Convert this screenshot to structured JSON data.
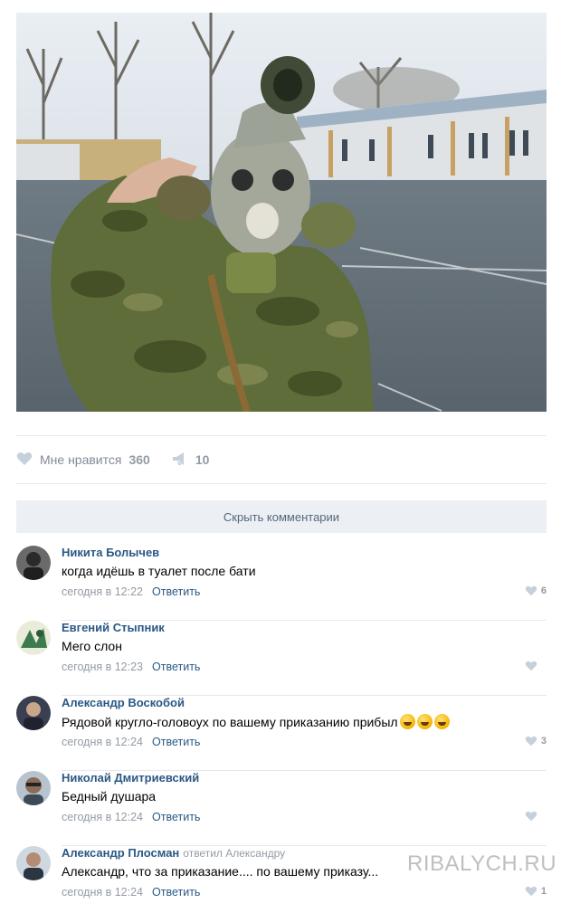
{
  "post": {
    "photo_icon": "soldier-saluting-in-gas-mask-photo",
    "likes_label": "Мне нравится",
    "likes_count": "360",
    "shares_count": "10"
  },
  "comments_toggle": {
    "label": "Скрыть комментарии"
  },
  "comments": [
    {
      "author": "Никита Болычев",
      "reply_to": "",
      "text": "когда идёшь в туалет после бати",
      "time": "сегодня в 12:22",
      "reply_label": "Ответить",
      "likes": "6"
    },
    {
      "author": "Евгений Стыпник",
      "reply_to": "",
      "text": "Мего слон",
      "time": "сегодня в 12:23",
      "reply_label": "Ответить",
      "likes": ""
    },
    {
      "author": "Александр Воскобой",
      "reply_to": "",
      "text": "Рядовой кругло-головоух по вашему приказанию прибыл",
      "time": "сегодня в 12:24",
      "reply_label": "Ответить",
      "likes": "3",
      "emoji": "tears-of-joy-emoji"
    },
    {
      "author": "Николай Дмитриевский",
      "reply_to": "",
      "text": "Бедный душара",
      "time": "сегодня в 12:24",
      "reply_label": "Ответить",
      "likes": ""
    },
    {
      "author": "Александр Плосман",
      "reply_to": "ответил Александру",
      "text": "Александр, что за приказание.... по вашему приказу...",
      "time": "сегодня в 12:24",
      "reply_label": "Ответить",
      "likes": "1"
    }
  ],
  "watermark": "RIBALYCH.RU",
  "colors": {
    "link": "#2a5885",
    "muted": "#939ba5",
    "button_bg": "#eceff3"
  }
}
